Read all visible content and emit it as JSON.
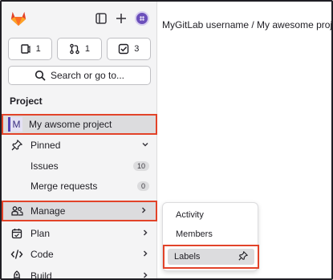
{
  "app": {
    "title": "MyGitLab username / My awesome project"
  },
  "topbar": {
    "logo_icon": "gitlab-tanuki-icon",
    "sidebar_toggle_icon": "sidebar-toggle-icon",
    "new_icon": "plus-icon",
    "avatar_icon": "user-avatar"
  },
  "counters": [
    {
      "icon": "issues-icon",
      "count": "1"
    },
    {
      "icon": "merge-request-icon",
      "count": "1"
    },
    {
      "icon": "todo-icon",
      "count": "3"
    }
  ],
  "search": {
    "label": "Search or go to..."
  },
  "sidebar": {
    "section_label": "Project",
    "project": {
      "initial": "M",
      "name": "My awsome project"
    },
    "pinned": {
      "label": "Pinned"
    },
    "issues": {
      "label": "Issues",
      "count": "10"
    },
    "merge_requests": {
      "label": "Merge requests",
      "count": "0"
    },
    "manage": {
      "label": "Manage"
    },
    "plan": {
      "label": "Plan"
    },
    "code": {
      "label": "Code"
    },
    "build": {
      "label": "Build"
    }
  },
  "flyout": {
    "activity": "Activity",
    "members": "Members",
    "labels": "Labels"
  },
  "colors": {
    "highlight_border": "#e24329",
    "accent": "#5643b8"
  }
}
